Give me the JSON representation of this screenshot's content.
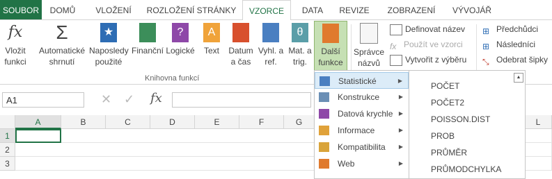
{
  "tabs": [
    "SOUBOR",
    "DOMŮ",
    "VLOŽENÍ",
    "ROZLOŽENÍ STRÁNKY",
    "VZORCE",
    "DATA",
    "REVIZE",
    "ZOBRAZENÍ",
    "VÝVOJÁŘ"
  ],
  "ribbon": {
    "insert_fn": "Vložit funkci",
    "autosum": "Automatické shrnutí",
    "recent": "Naposledy použité",
    "financial": "Finanční",
    "logical": "Logické",
    "text": "Text",
    "date": "Datum a čas",
    "lookup": "Vyhl. a ref.",
    "math": "Mat. a trig.",
    "more": "Další funkce",
    "name_mgr": "Správce názvů",
    "define_name": "Definovat název",
    "use_in_formula": "Použít ve vzorci",
    "create_from_sel": "Vytvořit z výběru",
    "trace_prec": "Předchůdci",
    "trace_dep": "Následníci",
    "remove_arrows": "Odebrat šipky",
    "group_label": "Knihovna funkcí"
  },
  "formula": {
    "namebox": "A1",
    "fx": "fx"
  },
  "columns": [
    "A",
    "B",
    "C",
    "D",
    "E",
    "F",
    "G",
    "L"
  ],
  "rows": [
    "1",
    "2",
    "3"
  ],
  "menu": [
    "Statistické",
    "Konstrukce",
    "Datová krychle",
    "Informace",
    "Kompatibilita",
    "Web"
  ],
  "submenu": [
    "POČET",
    "POČET2",
    "POISSON.DIST",
    "PROB",
    "PRŮMĚR",
    "PRŮMODCHYLKA"
  ],
  "colors": {
    "accent": "#217346",
    "highlight": "#c6e0b4",
    "menu_hl": "#dcecf8"
  }
}
